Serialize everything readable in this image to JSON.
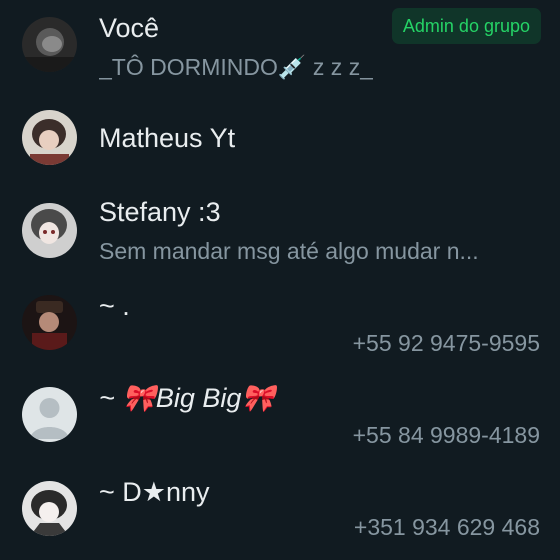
{
  "participants": [
    {
      "name": "Você",
      "status": "_TÔ DORMINDO💉 z z z_",
      "badge": "Admin do grupo",
      "avatar_icon": "dark-photo-avatar"
    },
    {
      "name": "Matheus Yt",
      "avatar_icon": "anime-photo-avatar"
    },
    {
      "name": "Stefany :3",
      "status": "Sem mandar msg até algo mudar n...",
      "avatar_icon": "anime-photo-avatar"
    },
    {
      "name": "~ .",
      "phone": "+55 92 9475-9595",
      "avatar_icon": "dark-photo-avatar"
    },
    {
      "name": "~ 🎀Big Big🎀",
      "phone": "+55 84 9989-4189",
      "avatar_icon": "default-person-avatar"
    },
    {
      "name": "~ D★nny",
      "phone": "+351 934 629 468",
      "avatar_icon": "anime-photo-avatar"
    }
  ],
  "colors": {
    "background": "#111b21",
    "primary_text": "#e9edef",
    "secondary_text": "#8696a0",
    "badge_bg": "#103529",
    "badge_text": "#25d366",
    "default_avatar_bg": "#dfe5e7",
    "default_avatar_fg": "#b5bec3"
  }
}
